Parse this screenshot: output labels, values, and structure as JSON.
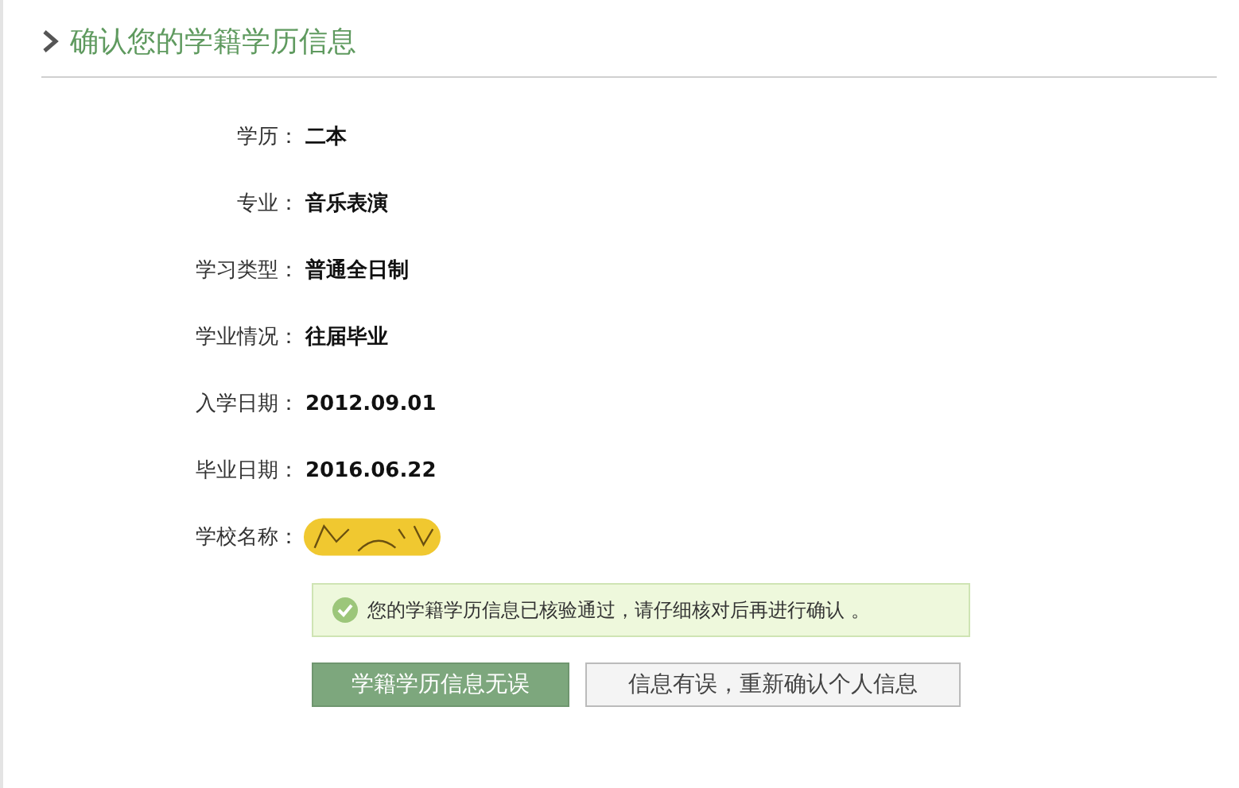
{
  "title": "确认您的学籍学历信息",
  "fields": [
    {
      "label": "学历：",
      "value": "二本",
      "kind": "text"
    },
    {
      "label": "专业：",
      "value": "音乐表演",
      "kind": "text"
    },
    {
      "label": "学习类型：",
      "value": "普通全日制",
      "kind": "text"
    },
    {
      "label": "学业情况：",
      "value": "往届毕业",
      "kind": "text"
    },
    {
      "label": "入学日期：",
      "value": "2012.09.01",
      "kind": "text"
    },
    {
      "label": "毕业日期：",
      "value": "2016.06.22",
      "kind": "text"
    },
    {
      "label": "学校名称：",
      "kind": "redacted"
    }
  ],
  "notice": "您的学籍学历信息已核验通过，请仔细核对后再进行确认 。",
  "buttons": [
    {
      "label": "学籍学历信息无误",
      "kind": "primary"
    },
    {
      "label": "信息有误，重新确认个人信息",
      "kind": "secondary"
    }
  ]
}
